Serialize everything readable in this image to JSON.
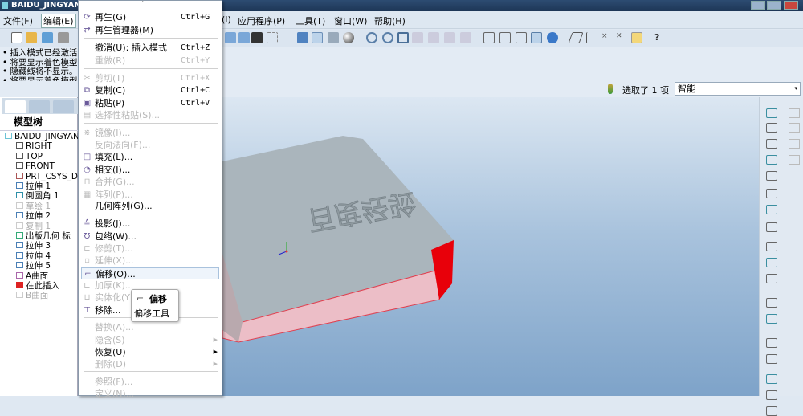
{
  "window": {
    "title": "BAIDU_JINGYAN (活"
  },
  "menubar": {
    "items": [
      "文件(F)",
      "编辑(E)",
      "(I)",
      "应用程序(P)",
      "工具(T)",
      "窗口(W)",
      "帮助(H)"
    ]
  },
  "messages": [
    "• 插入模式已经激活。",
    "• 将要显示着色模型",
    "• 隐藏线将不显示。",
    "• 将要显示着色模型"
  ],
  "selection": {
    "status": "选取了 1 项",
    "filter": "智能"
  },
  "model_tree": {
    "title": "模型树",
    "items": [
      {
        "label": "BAIDU_JINGYAN.",
        "icon": "part-icon",
        "disabled": false
      },
      {
        "label": "RIGHT",
        "icon": "datum-plane-icon",
        "disabled": false
      },
      {
        "label": "TOP",
        "icon": "datum-plane-icon",
        "disabled": false
      },
      {
        "label": "FRONT",
        "icon": "datum-plane-icon",
        "disabled": false
      },
      {
        "label": "PRT_CSYS_DEF",
        "icon": "csys-icon",
        "disabled": false
      },
      {
        "label": "拉伸 1",
        "icon": "extrude-icon",
        "disabled": false
      },
      {
        "label": "倒圆角 1",
        "icon": "round-icon",
        "disabled": false
      },
      {
        "label": "草绘 1",
        "icon": "sketch-icon",
        "disabled": true
      },
      {
        "label": "拉伸 2",
        "icon": "extrude-icon",
        "disabled": false
      },
      {
        "label": "复制 1",
        "icon": "copy-icon",
        "disabled": true
      },
      {
        "label": "出版几何 标",
        "icon": "publish-geom-icon",
        "disabled": false
      },
      {
        "label": "拉伸 3",
        "icon": "extrude-icon",
        "disabled": false
      },
      {
        "label": "拉伸 4",
        "icon": "extrude-icon",
        "disabled": false
      },
      {
        "label": "拉伸 5",
        "icon": "extrude-icon",
        "disabled": false
      },
      {
        "label": "A曲面",
        "icon": "surface-icon",
        "disabled": false
      },
      {
        "label": "在此插入",
        "icon": "insert-here-icon",
        "disabled": false
      },
      {
        "label": "B曲面",
        "icon": "surface-icon",
        "disabled": true
      }
    ]
  },
  "edit_menu": {
    "items": [
      {
        "label": "再生(G)",
        "shortcut": "Ctrl+G",
        "disabled": false
      },
      {
        "label": "再生管理器(M)",
        "shortcut": "",
        "disabled": false
      },
      {
        "label": "撤消(U):  插入模式",
        "shortcut": "Ctrl+Z",
        "disabled": false
      },
      {
        "label": "重做(R)",
        "shortcut": "Ctrl+Y",
        "disabled": true
      },
      {
        "label": "剪切(T)",
        "shortcut": "Ctrl+X",
        "disabled": true
      },
      {
        "label": "复制(C)",
        "shortcut": "Ctrl+C",
        "disabled": false
      },
      {
        "label": "粘贴(P)",
        "shortcut": "Ctrl+V",
        "disabled": false
      },
      {
        "label": "选择性粘贴(S)...",
        "shortcut": "",
        "disabled": true
      },
      {
        "label": "镜像(I)...",
        "shortcut": "",
        "disabled": true
      },
      {
        "label": "反向法向(F)...",
        "shortcut": "",
        "disabled": true
      },
      {
        "label": "填充(L)...",
        "shortcut": "",
        "disabled": false
      },
      {
        "label": "相交(I)...",
        "shortcut": "",
        "disabled": false
      },
      {
        "label": "合并(G)...",
        "shortcut": "",
        "disabled": true
      },
      {
        "label": "阵列(P)...",
        "shortcut": "",
        "disabled": true
      },
      {
        "label": "几何阵列(G)...",
        "shortcut": "",
        "disabled": false
      },
      {
        "label": "投影(J)...",
        "shortcut": "",
        "disabled": false
      },
      {
        "label": "包络(W)...",
        "shortcut": "",
        "disabled": false
      },
      {
        "label": "修剪(T)...",
        "shortcut": "",
        "disabled": true
      },
      {
        "label": "延伸(X)...",
        "shortcut": "",
        "disabled": true
      },
      {
        "label": "偏移(O)...",
        "shortcut": "",
        "disabled": false,
        "highlighted": true
      },
      {
        "label": "加厚(K)...",
        "shortcut": "",
        "disabled": true
      },
      {
        "label": "实体化(Y)...",
        "shortcut": "",
        "disabled": true
      },
      {
        "label": "移除...",
        "shortcut": "",
        "disabled": false
      },
      {
        "label": "替换(A)...",
        "shortcut": "",
        "disabled": true
      },
      {
        "label": "隐含(S)",
        "shortcut": "",
        "disabled": true,
        "submenu": true
      },
      {
        "label": "恢复(U)",
        "shortcut": "",
        "disabled": false,
        "submenu": true
      },
      {
        "label": "删除(D)",
        "shortcut": "",
        "disabled": true,
        "submenu": true
      },
      {
        "label": "参照(F)...",
        "shortcut": "",
        "disabled": true
      },
      {
        "label": "定义(N)...",
        "shortcut": "",
        "disabled": true
      }
    ]
  },
  "tooltip": {
    "title": "偏移",
    "description": "偏移工具"
  },
  "model": {
    "embossed_text": "百度经验",
    "colors": {
      "body": "#a9b5bd",
      "side": "#e9b7c1",
      "highlight": "#e8000a"
    }
  }
}
